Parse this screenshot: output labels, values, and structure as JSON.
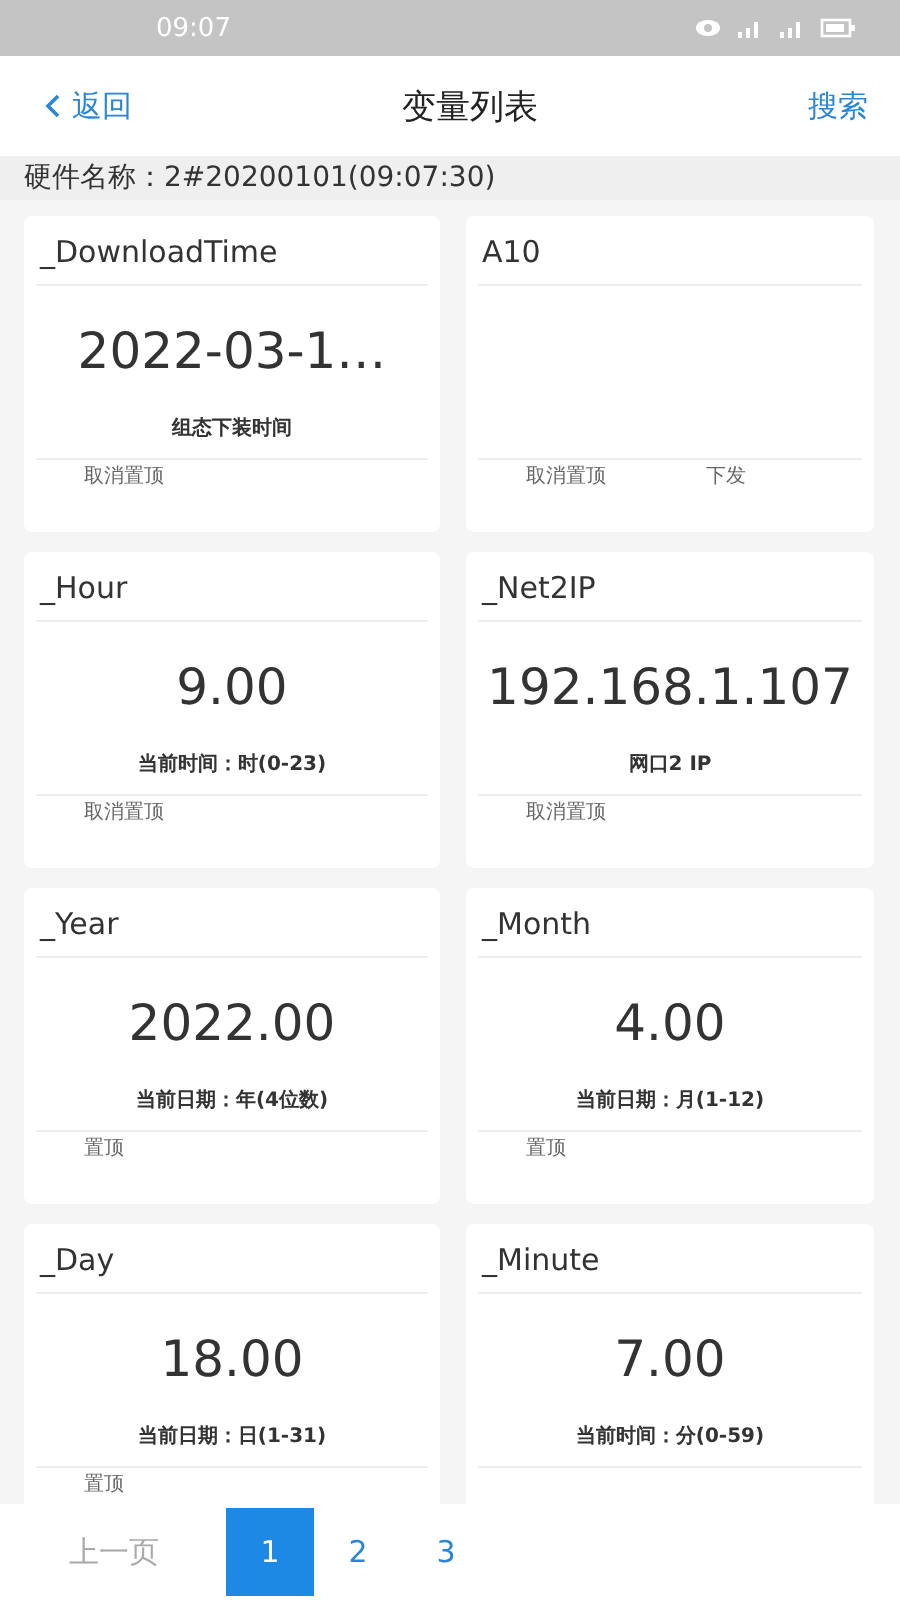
{
  "status_bar": {
    "time": "09:07"
  },
  "header": {
    "back": "返回",
    "title": "变量列表",
    "search": "搜索"
  },
  "hardware": {
    "label": "硬件名称：",
    "value": "2#20200101(09:07:30)"
  },
  "cards": [
    {
      "name": "_DownloadTime",
      "value": "2022-03-1…",
      "description": "组态下装时间",
      "actions": [
        "取消置顶"
      ]
    },
    {
      "name": "A10",
      "actions": [
        "取消置顶",
        "下发"
      ]
    },
    {
      "name": "_Hour",
      "value": "9.00",
      "description": "当前时间：时(0-23)",
      "actions": [
        "取消置顶"
      ]
    },
    {
      "name": "_Net2IP",
      "value": "192.168.1.107",
      "description": "网口2 IP",
      "actions": [
        "取消置顶"
      ]
    },
    {
      "name": "_Year",
      "value": "2022.00",
      "description": "当前日期：年(4位数)",
      "actions": [
        "置顶"
      ]
    },
    {
      "name": "_Month",
      "value": "4.00",
      "description": "当前日期：月(1-12)",
      "actions": [
        "置顶"
      ]
    },
    {
      "name": "_Day",
      "value": "18.00",
      "description": "当前日期：日(1-31)",
      "actions": [
        "置顶"
      ]
    },
    {
      "name": "_Minute",
      "value": "7.00",
      "description": "当前时间：分(0-59)"
    }
  ],
  "pagination": {
    "previous": {
      "label": "上一页",
      "disabled": true
    },
    "pages": [
      {
        "label": "1",
        "selected": true
      },
      {
        "label": "2",
        "selected": false
      },
      {
        "label": "3",
        "selected": false
      }
    ]
  }
}
